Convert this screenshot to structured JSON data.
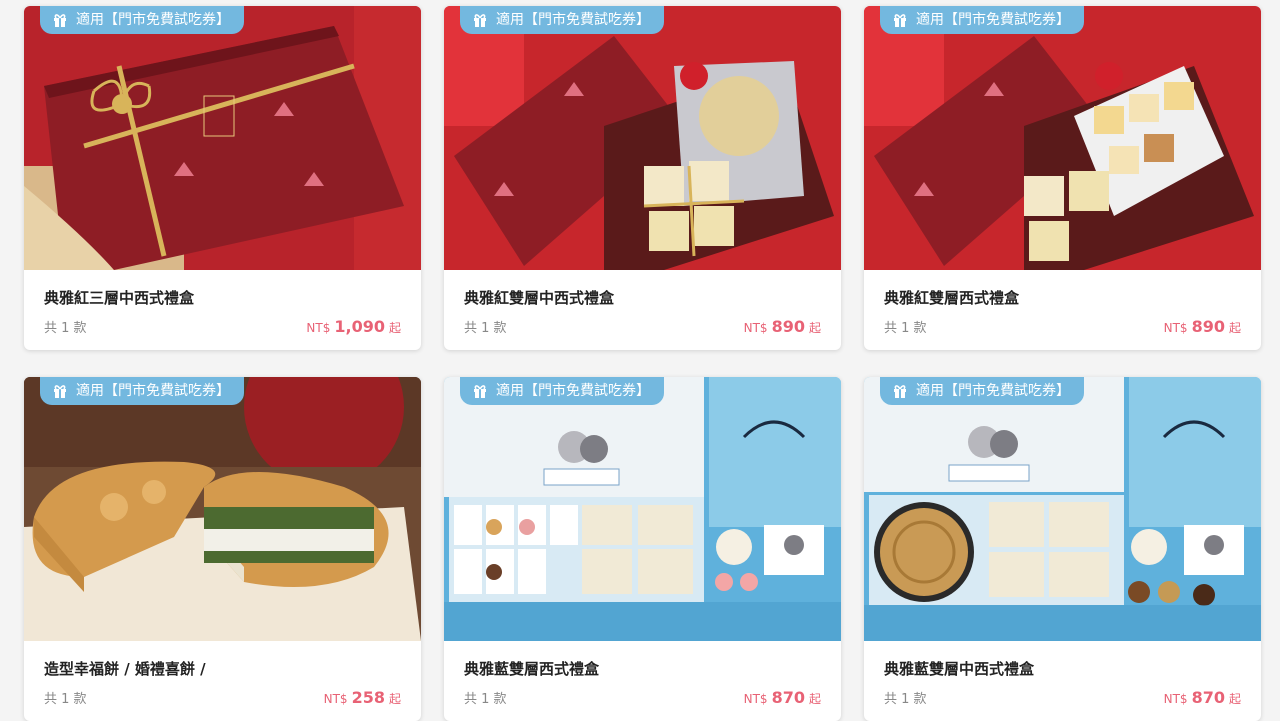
{
  "badge_label": "適用【門市免費試吃券】",
  "products": [
    {
      "name": "典雅紅三層中西式禮盒",
      "count": "共 1 款",
      "currency": "NT$",
      "price": "1,090",
      "suffix": "起",
      "theme": "red"
    },
    {
      "name": "典雅紅雙層中西式禮盒",
      "count": "共 1 款",
      "currency": "NT$",
      "price": "890",
      "suffix": "起",
      "theme": "red"
    },
    {
      "name": "典雅紅雙層西式禮盒",
      "count": "共 1 款",
      "currency": "NT$",
      "price": "890",
      "suffix": "起",
      "theme": "red"
    },
    {
      "name": "造型幸福餅 / 婚禮喜餅 /",
      "count": "共 1 款",
      "currency": "NT$",
      "price": "258",
      "suffix": "起",
      "theme": "cake"
    },
    {
      "name": "典雅藍雙層西式禮盒",
      "count": "共 1 款",
      "currency": "NT$",
      "price": "870",
      "suffix": "起",
      "theme": "blue"
    },
    {
      "name": "典雅藍雙層中西式禮盒",
      "count": "共 1 款",
      "currency": "NT$",
      "price": "870",
      "suffix": "起",
      "theme": "blue"
    }
  ],
  "colors": {
    "badge": "#73b8df",
    "price": "#e86275",
    "red_box": "#8e1d25",
    "blue_box": "#5fb1dc"
  },
  "icons": {
    "badge": "gift-icon"
  }
}
